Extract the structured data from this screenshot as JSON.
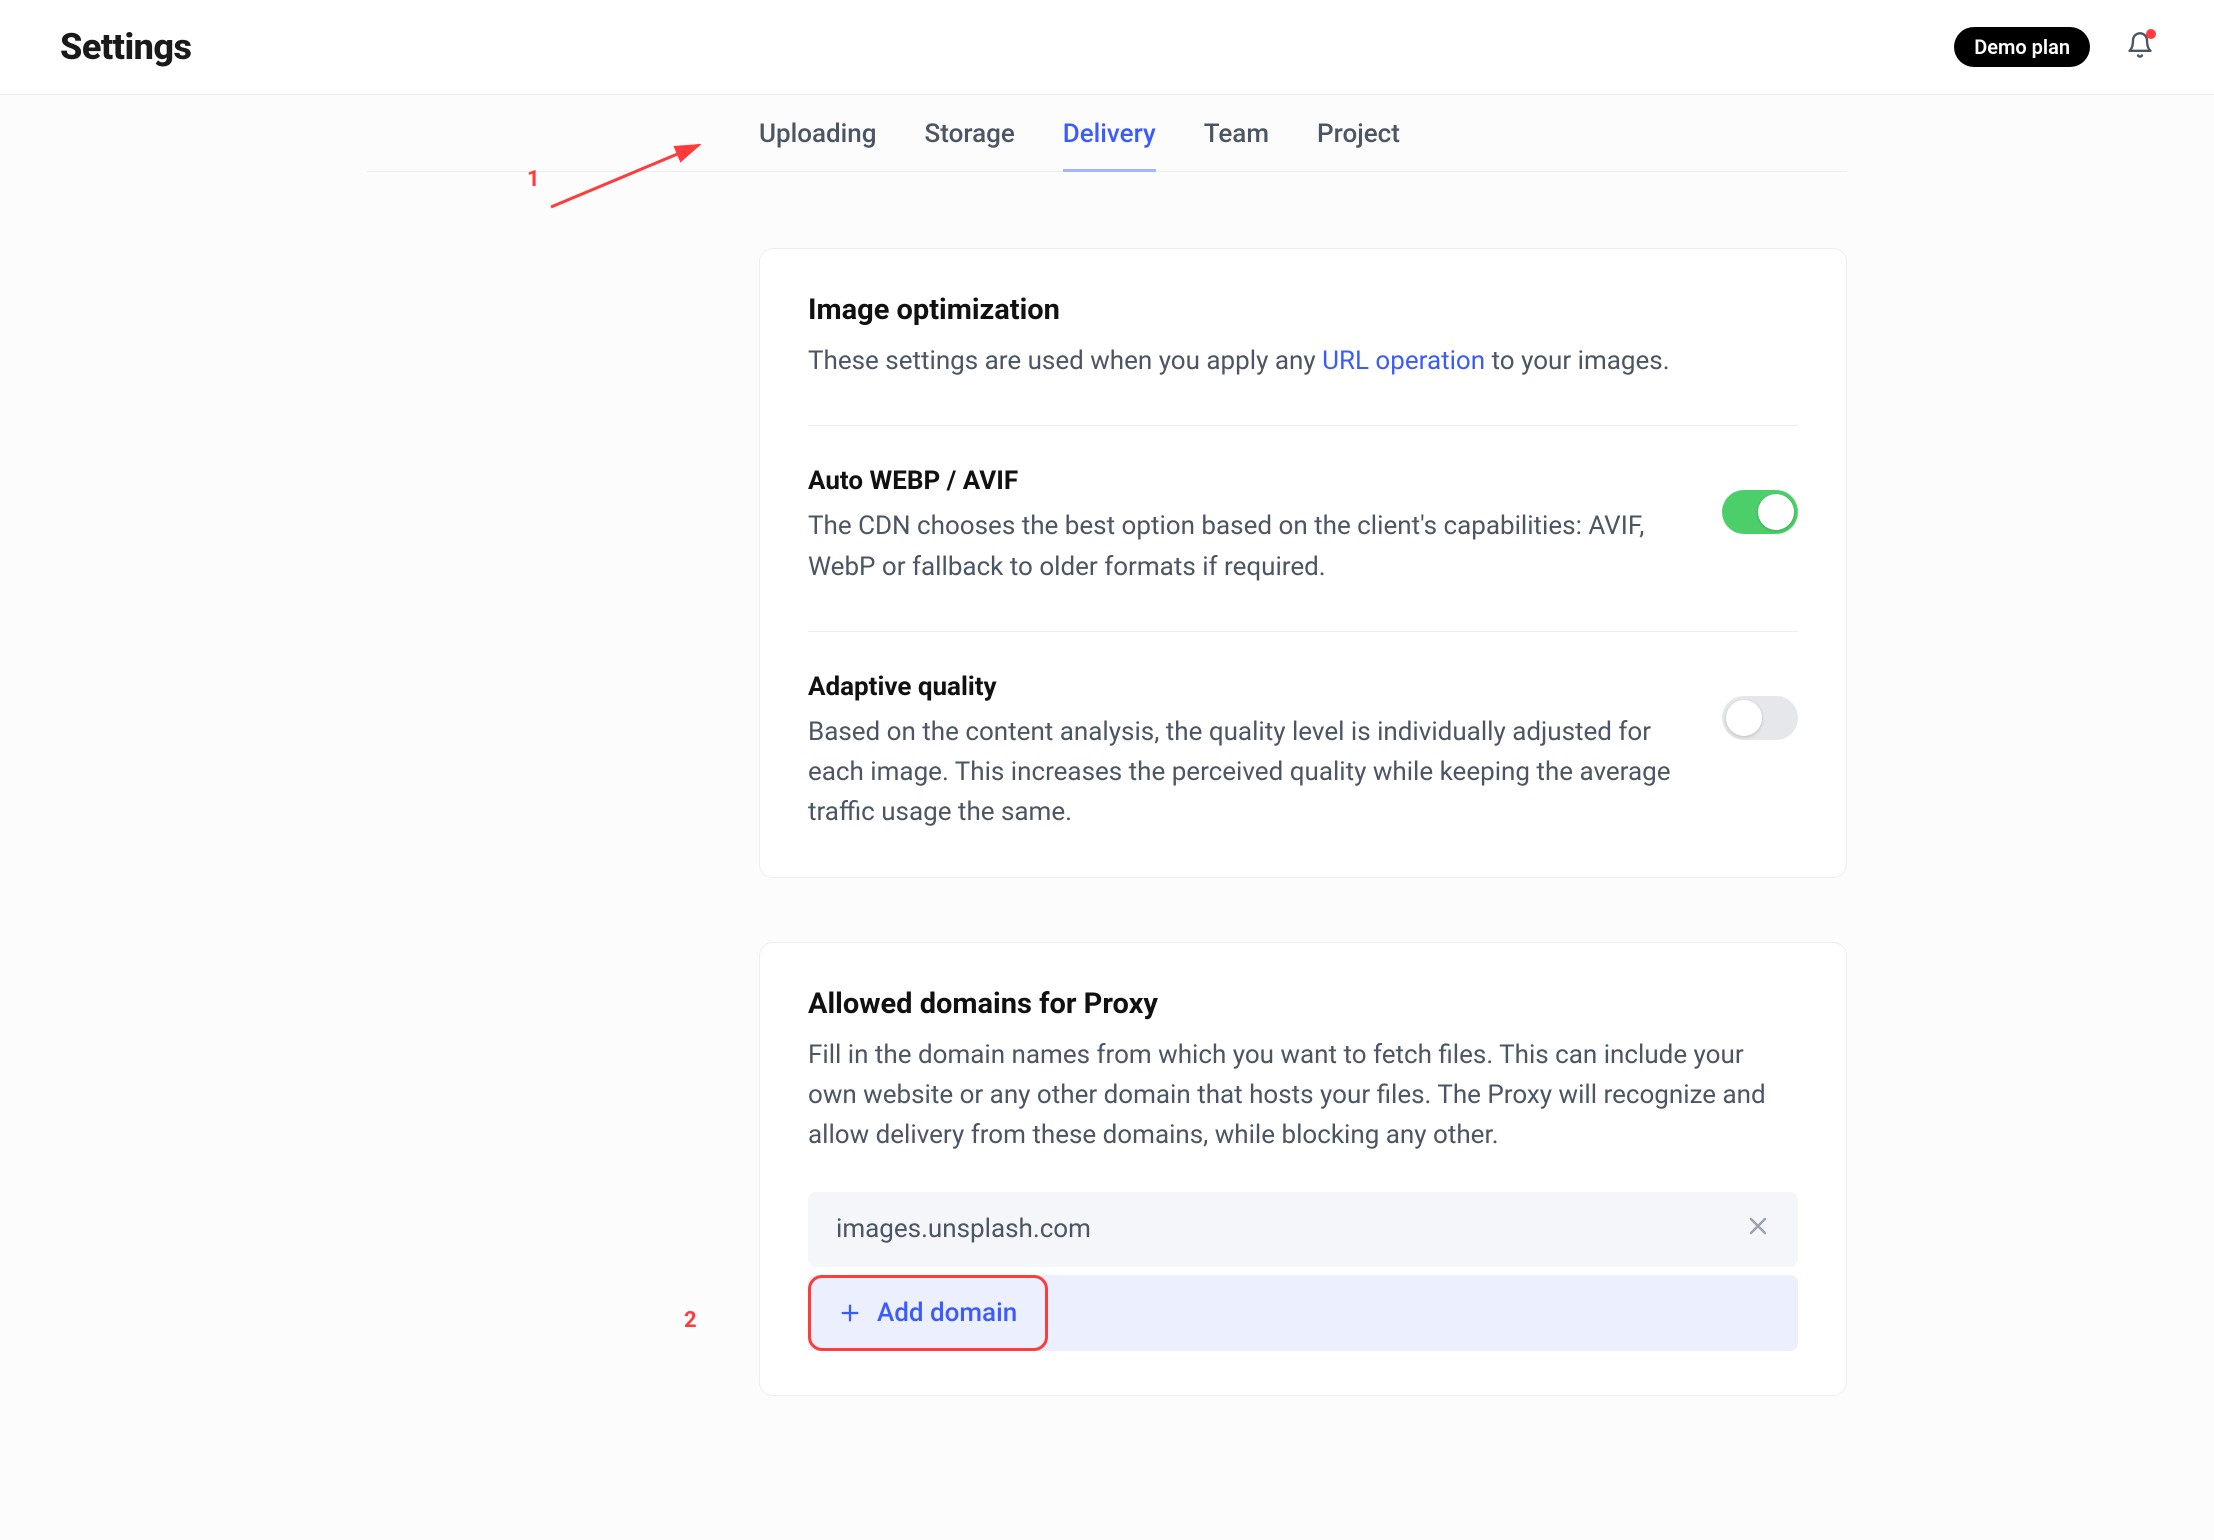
{
  "header": {
    "title": "Settings",
    "plan_badge": "Demo plan"
  },
  "tabs": [
    {
      "label": "Uploading",
      "active": false
    },
    {
      "label": "Storage",
      "active": false
    },
    {
      "label": "Delivery",
      "active": true
    },
    {
      "label": "Team",
      "active": false
    },
    {
      "label": "Project",
      "active": false
    }
  ],
  "image_opt": {
    "title": "Image optimization",
    "desc_before": "These settings are used when you apply any ",
    "desc_link": "URL operation",
    "desc_after": " to your images.",
    "auto_webp": {
      "title": "Auto WEBP / AVIF",
      "desc": "The CDN chooses the best option based on the client's capabilities: AVIF, WebP or fallback to older formats if required.",
      "enabled": true
    },
    "adaptive": {
      "title": "Adaptive quality",
      "desc": "Based on the content analysis, the quality level is individually adjusted for each image. This increases the perceived quality while keeping the average traffic usage the same.",
      "enabled": false
    }
  },
  "proxy": {
    "title": "Allowed domains for Proxy",
    "desc": "Fill in the domain names from which you want to fetch files. This can include your own website or any other domain that hosts your files. The Proxy will recognize and allow delivery from these domains, while blocking any other.",
    "domains": [
      "images.unsplash.com"
    ],
    "add_label": "Add domain"
  },
  "annotations": {
    "one": "1",
    "two": "2"
  }
}
